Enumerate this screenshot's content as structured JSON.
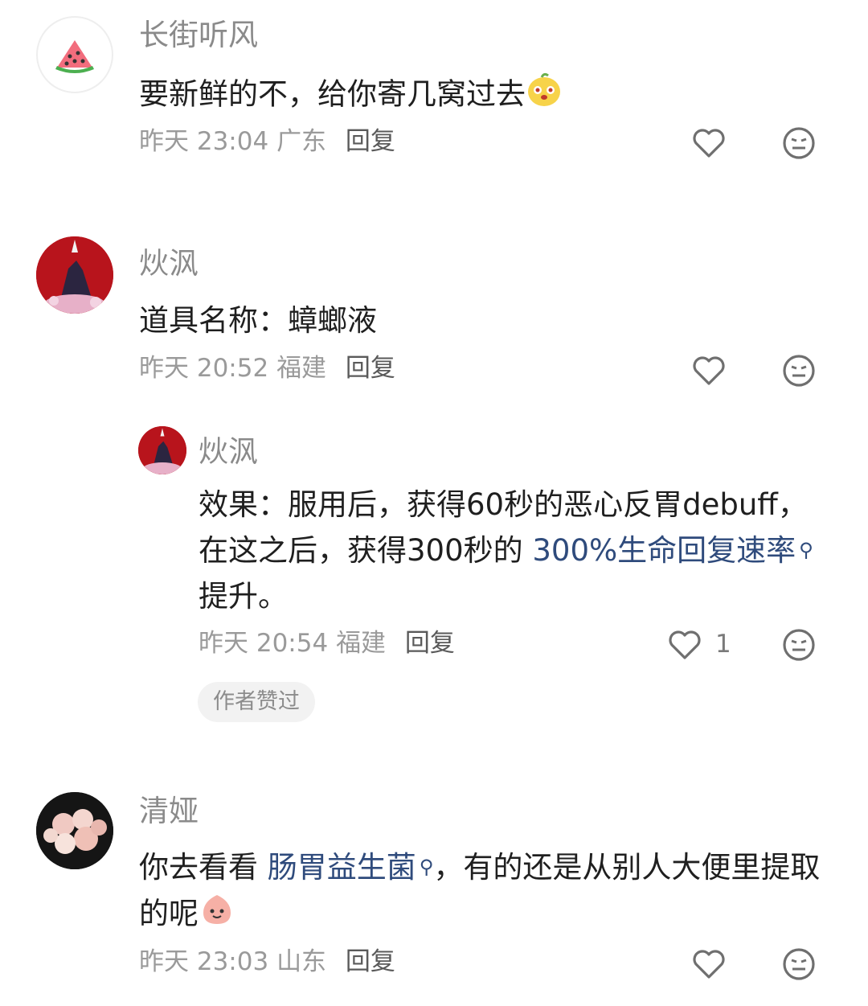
{
  "comments": [
    {
      "name": "长街听风",
      "text": "要新鲜的不，给你寄几窝过去",
      "time": "昨天 23:04",
      "location": "广东",
      "reply_label": "回复",
      "avatar_icon": "watermelon-icon"
    },
    {
      "name": "炏沨",
      "text": "道具名称：蟑螂液",
      "time": "昨天 20:52",
      "location": "福建",
      "reply_label": "回复",
      "avatar_icon": "character-avatar"
    },
    {
      "name": "炏沨",
      "text_before": "效果：服用后，获得60秒的恶心反胃debuff，在这之后，获得300秒的 ",
      "link_text": "300%生命回复速率",
      "text_after": "提升。",
      "time": "昨天 20:54",
      "location": "福建",
      "reply_label": "回复",
      "like_count": "1",
      "badge": "作者赞过",
      "avatar_icon": "character-avatar"
    },
    {
      "name": "清娅",
      "text_before": "你去看看 ",
      "link_text": "肠胃益生菌",
      "text_after": "，有的还是从别人大便里提取的呢",
      "time": "昨天 23:03",
      "location": "山东",
      "reply_label": "回复",
      "avatar_icon": "flowers-avatar"
    }
  ],
  "icons": {
    "like": "heart-outline-icon",
    "dislike": "meh-face-icon",
    "search": "search-icon"
  },
  "colors": {
    "link": "#2f4b7c",
    "meta": "#9a9a9a",
    "name": "#8a8a8a",
    "text": "#1f1f1f"
  }
}
